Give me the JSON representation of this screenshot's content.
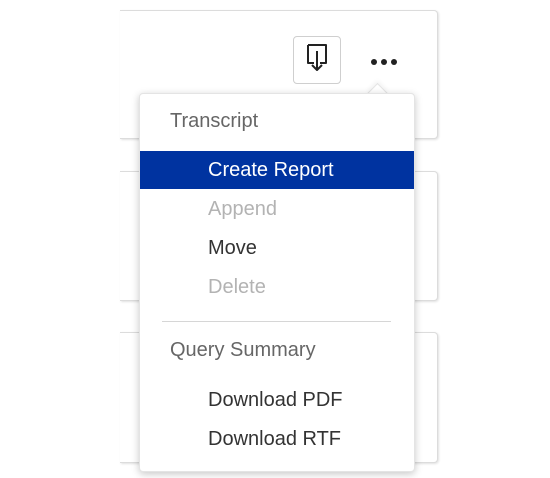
{
  "toolbar": {
    "download_icon": "download-to-tray-icon",
    "more_icon": "more-horizontal-icon"
  },
  "menu": {
    "sections": [
      {
        "header": "Transcript",
        "items": [
          {
            "label": "Create Report",
            "state": "selected"
          },
          {
            "label": "Append",
            "state": "disabled"
          },
          {
            "label": "Move",
            "state": "enabled"
          },
          {
            "label": "Delete",
            "state": "disabled"
          }
        ]
      },
      {
        "header": "Query Summary",
        "items": [
          {
            "label": "Download PDF",
            "state": "enabled"
          },
          {
            "label": "Download RTF",
            "state": "enabled"
          }
        ]
      }
    ]
  },
  "colors": {
    "selected_background": "#0033a0",
    "selected_text": "#ffffff",
    "disabled_text": "#b3b3b3",
    "item_text": "#333333",
    "header_text": "#666666"
  }
}
